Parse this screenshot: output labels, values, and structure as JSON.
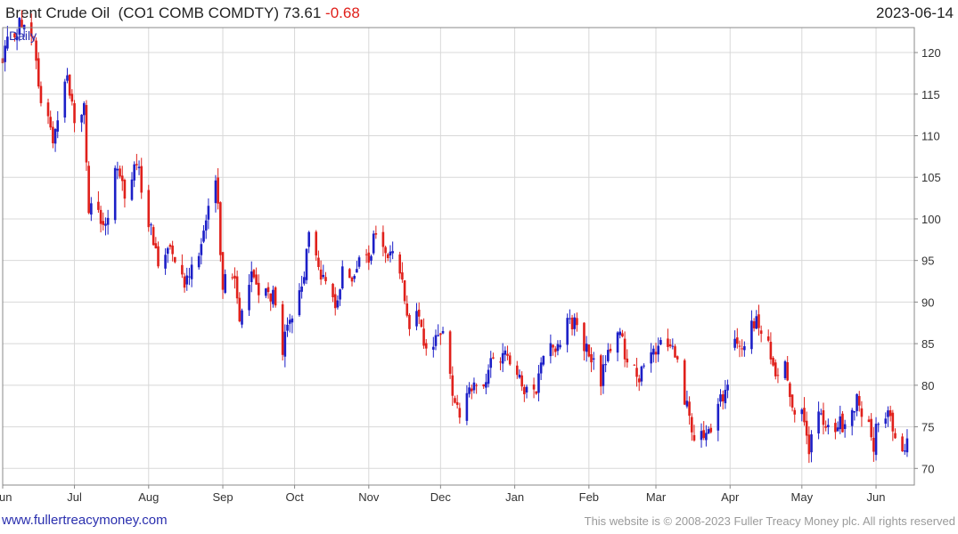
{
  "header": {
    "name": "Brent Crude Oil",
    "ticker": "(CO1 COMB COMDTY)",
    "last": "73.61",
    "change": "-0.68",
    "date": "2023-06-14"
  },
  "footer": {
    "site": "www.fullertreacymoney.com",
    "copyright": "This website is © 2008-2023 Fuller Treacy Money plc. All rights reserved"
  },
  "colors": {
    "up": "#1c1fc7",
    "down": "#e0201b",
    "grid": "#d8d8d8"
  },
  "chart_data": {
    "type": "candlestick",
    "interval_label": "Daily",
    "y_ticks": [
      70,
      75,
      80,
      85,
      90,
      95,
      100,
      105,
      110,
      115,
      120
    ],
    "ylim": [
      68,
      123
    ],
    "xlim": [
      "2022-06-01",
      "2023-06-17"
    ],
    "x_ticks": [
      {
        "label": "Jun",
        "date": "2022-06-01"
      },
      {
        "label": "Jul",
        "date": "2022-07-01"
      },
      {
        "label": "Aug",
        "date": "2022-08-01"
      },
      {
        "label": "Sep",
        "date": "2022-09-01"
      },
      {
        "label": "Oct",
        "date": "2022-10-01"
      },
      {
        "label": "Nov",
        "date": "2022-11-01"
      },
      {
        "label": "Dec",
        "date": "2022-12-01"
      },
      {
        "label": "Jan",
        "date": "2023-01-01"
      },
      {
        "label": "Feb",
        "date": "2023-02-01"
      },
      {
        "label": "Mar",
        "date": "2023-03-01"
      },
      {
        "label": "Apr",
        "date": "2023-04-01"
      },
      {
        "label": "May",
        "date": "2023-05-01"
      },
      {
        "label": "Jun",
        "date": "2023-06-01"
      }
    ],
    "grid": true,
    "close_points": [
      [
        "2022-06-01",
        118.5
      ],
      [
        "2022-06-03",
        121
      ],
      [
        "2022-06-08",
        123.5
      ],
      [
        "2022-06-14",
        121
      ],
      [
        "2022-06-17",
        114
      ],
      [
        "2022-06-22",
        110
      ],
      [
        "2022-06-28",
        117.5
      ],
      [
        "2022-07-01",
        111.5
      ],
      [
        "2022-07-05",
        113.5
      ],
      [
        "2022-07-07",
        101
      ],
      [
        "2022-07-12",
        100
      ],
      [
        "2022-07-14",
        98.5
      ],
      [
        "2022-07-19",
        107
      ],
      [
        "2022-07-22",
        103
      ],
      [
        "2022-07-27",
        106.5
      ],
      [
        "2022-08-01",
        100
      ],
      [
        "2022-08-05",
        94.5
      ],
      [
        "2022-08-10",
        97.5
      ],
      [
        "2022-08-16",
        92.5
      ],
      [
        "2022-08-22",
        96.5
      ],
      [
        "2022-08-26",
        100.5
      ],
      [
        "2022-08-29",
        105
      ],
      [
        "2022-09-01",
        92.5
      ],
      [
        "2022-09-06",
        93
      ],
      [
        "2022-09-08",
        88.5
      ],
      [
        "2022-09-13",
        93.5
      ],
      [
        "2022-09-16",
        91.5
      ],
      [
        "2022-09-22",
        90.5
      ],
      [
        "2022-09-26",
        84.5
      ],
      [
        "2022-09-30",
        88
      ],
      [
        "2022-10-04",
        91.5
      ],
      [
        "2022-10-07",
        98
      ],
      [
        "2022-10-11",
        94.5
      ],
      [
        "2022-10-14",
        91.5
      ],
      [
        "2022-10-18",
        90
      ],
      [
        "2022-10-21",
        93.5
      ],
      [
        "2022-10-25",
        93.5
      ],
      [
        "2022-10-28",
        95.5
      ],
      [
        "2022-11-01",
        94.5
      ],
      [
        "2022-11-04",
        98.5
      ],
      [
        "2022-11-08",
        95.5
      ],
      [
        "2022-11-11",
        95.5
      ],
      [
        "2022-11-15",
        93
      ],
      [
        "2022-11-18",
        87.5
      ],
      [
        "2022-11-22",
        88
      ],
      [
        "2022-11-25",
        83.5
      ],
      [
        "2022-11-30",
        86.5
      ],
      [
        "2022-12-02",
        86
      ],
      [
        "2022-12-06",
        79.5
      ],
      [
        "2022-12-09",
        76
      ],
      [
        "2022-12-13",
        80.5
      ],
      [
        "2022-12-16",
        79
      ],
      [
        "2022-12-20",
        80
      ],
      [
        "2022-12-23",
        83.5
      ],
      [
        "2022-12-28",
        83.5
      ],
      [
        "2023-01-03",
        82
      ],
      [
        "2023-01-05",
        78.5
      ],
      [
        "2023-01-10",
        80
      ],
      [
        "2023-01-13",
        84.5
      ],
      [
        "2023-01-18",
        84.5
      ],
      [
        "2023-01-23",
        88
      ],
      [
        "2023-01-27",
        87
      ],
      [
        "2023-02-01",
        83.5
      ],
      [
        "2023-02-06",
        80.5
      ],
      [
        "2023-02-09",
        84.5
      ],
      [
        "2023-02-14",
        86
      ],
      [
        "2023-02-17",
        83
      ],
      [
        "2023-02-22",
        81
      ],
      [
        "2023-02-27",
        83
      ],
      [
        "2023-03-02",
        84.5
      ],
      [
        "2023-03-07",
        85.5
      ],
      [
        "2023-03-10",
        82.5
      ],
      [
        "2023-03-14",
        77.5
      ],
      [
        "2023-03-17",
        72.5
      ],
      [
        "2023-03-20",
        73.5
      ],
      [
        "2023-03-24",
        74.5
      ],
      [
        "2023-03-28",
        78
      ],
      [
        "2023-03-31",
        80
      ],
      [
        "2023-04-03",
        84.5
      ],
      [
        "2023-04-06",
        85
      ],
      [
        "2023-04-12",
        87.5
      ],
      [
        "2023-04-17",
        84.5
      ],
      [
        "2023-04-20",
        81
      ],
      [
        "2023-04-24",
        83
      ],
      [
        "2023-04-27",
        78
      ],
      [
        "2023-05-02",
        75.5
      ],
      [
        "2023-05-04",
        72.5
      ],
      [
        "2023-05-08",
        76.5
      ],
      [
        "2023-05-11",
        74.5
      ],
      [
        "2023-05-16",
        75
      ],
      [
        "2023-05-19",
        75.5
      ],
      [
        "2023-05-24",
        78
      ],
      [
        "2023-05-26",
        77
      ],
      [
        "2023-05-31",
        73
      ],
      [
        "2023-06-02",
        76
      ],
      [
        "2023-06-05",
        77
      ],
      [
        "2023-06-09",
        74.5
      ],
      [
        "2023-06-12",
        72
      ],
      [
        "2023-06-14",
        73.61
      ]
    ]
  }
}
